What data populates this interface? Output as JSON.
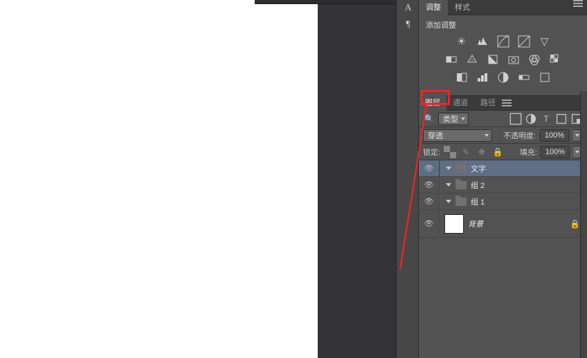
{
  "vtools": {
    "t1": "A",
    "t2": "¶"
  },
  "adjustments": {
    "tabs": {
      "adjust": "调整",
      "styles": "样式"
    },
    "title": "添加调整"
  },
  "layers_panel": {
    "tabs": {
      "layers": "图层",
      "channels": "通道",
      "paths": "路径"
    },
    "filter_label": "类型",
    "blend_mode": "穿透",
    "opacity_label": "不透明度:",
    "opacity_value": "100%",
    "lock_label": "锁定:",
    "fill_label": "填充:",
    "fill_value": "100%",
    "layers": [
      {
        "name": "文字"
      },
      {
        "name": "组 2"
      },
      {
        "name": "组 1"
      },
      {
        "name": "背景"
      }
    ]
  }
}
